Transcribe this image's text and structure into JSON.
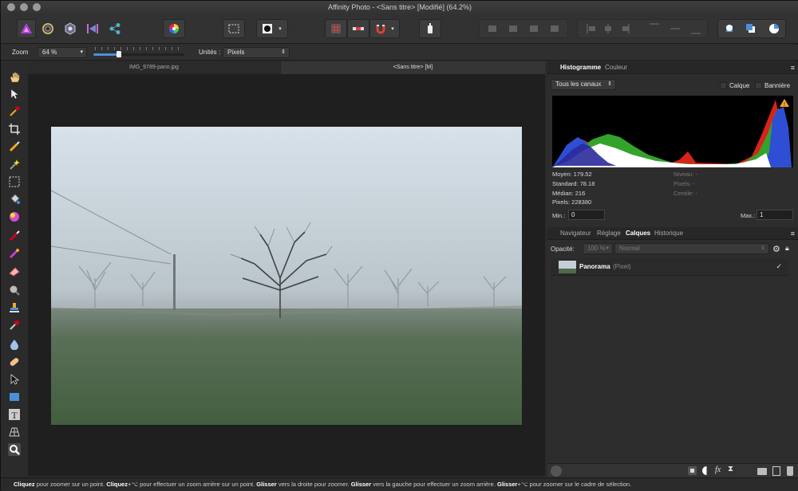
{
  "window": {
    "title": "Affinity Photo - <Sans titre> [Modifié] (64.2%)"
  },
  "context_bar": {
    "zoom_label": "Zoom",
    "zoom_value": "64 %",
    "units_label": "Unités :",
    "units_value": "Pixels"
  },
  "doc_tabs": [
    {
      "label": "IMG_9789-pano.jpg"
    },
    {
      "label": "<Sans titre> [M]"
    }
  ],
  "histogram_panel": {
    "tabs": [
      "Histogramme",
      "Couleur"
    ],
    "channel_select": "Tous les canaux",
    "check_layer": "Calque",
    "check_banner": "Bannière",
    "stats_left": {
      "moyen": "Moyen: 179.52",
      "standard": "Standard: 78.18",
      "median": "Médian: 216",
      "pixels": "Pixels: 228380"
    },
    "stats_right": {
      "niveau": "Niveau: -",
      "pixels": "Pixels: -",
      "centile": "Centile: -"
    },
    "min_label": "Min.:",
    "min_value": "0",
    "max_label": "Max.:",
    "max_value": "1"
  },
  "layers_panel": {
    "tabs": [
      "Navigateur",
      "Réglage",
      "Calques",
      "Historique"
    ],
    "opacity_label": "Opacité:",
    "opacity_value": "100 %",
    "blend_mode": "Normal",
    "layer": {
      "name": "Panorama",
      "type": "(Pixel)",
      "visible_mark": "✓"
    }
  },
  "status_bar": {
    "s1": "Cliquez",
    "t1": " pour zoomer sur un point. ",
    "s2": "Cliquez",
    "t2": "+⌥ pour effectuer un zoom arrière sur un point. ",
    "s3": "Glisser",
    "t3": " vers la droite pour zoomer. ",
    "s4": "Glisser",
    "t4": " vers la gauche pour effectuer un zoom arrière. ",
    "s5": "Glisser",
    "t5": "+⌥ pour zoomer sur le cadre de sélection."
  },
  "colors": {
    "accent": "#a23bd4",
    "panel_bg": "#2d2d2d"
  }
}
